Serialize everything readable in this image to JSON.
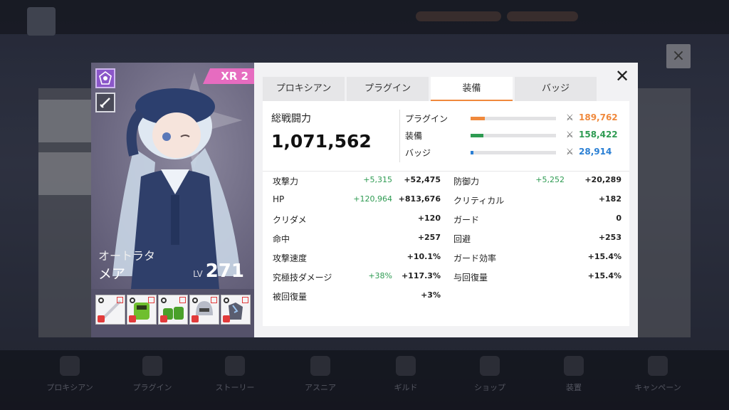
{
  "colors": {
    "plugin": "#f0893c",
    "equip": "#2e9b52",
    "badge": "#2a7fd4",
    "xr_tag": "#e66cc0",
    "tab_active_underline": "#f0893c",
    "bonus": "#2e9b52"
  },
  "character": {
    "xr_rank": "XR 2",
    "title": "オートラタ",
    "name": "メア",
    "lv_label": "LV",
    "level": "271",
    "attribute_icon": "attribute-icon",
    "weapon_icon": "sword-icon",
    "equipment": [
      {
        "name": "equipment-slot-1",
        "icon": "blade-icon",
        "color": "#c9c9d2"
      },
      {
        "name": "equipment-slot-2",
        "icon": "armor-green-icon",
        "color": "#6fbf2e"
      },
      {
        "name": "equipment-slot-3",
        "icon": "boots-green-icon",
        "color": "#4aa02a"
      },
      {
        "name": "equipment-slot-4",
        "icon": "helmet-icon",
        "color": "#b8bcc8"
      },
      {
        "name": "equipment-slot-5",
        "icon": "gauntlet-icon",
        "color": "#5a5e70"
      }
    ]
  },
  "tabs": [
    {
      "label": "プロキシアン",
      "active": false
    },
    {
      "label": "プラグイン",
      "active": false
    },
    {
      "label": "装備",
      "active": true
    },
    {
      "label": "バッジ",
      "active": false
    }
  ],
  "power": {
    "label": "総戦闘力",
    "value": "1,071,562"
  },
  "breakdown": [
    {
      "label": "プラグイン",
      "value": "189,762",
      "fraction": 0.17,
      "color": "#f0893c"
    },
    {
      "label": "装備",
      "value": "158,422",
      "fraction": 0.15,
      "color": "#2e9b52"
    },
    {
      "label": "バッジ",
      "value": "28,914",
      "fraction": 0.03,
      "color": "#2a7fd4"
    }
  ],
  "stats_left": [
    {
      "label": "攻撃力",
      "bonus": "+5,315",
      "value": "+52,475"
    },
    {
      "label": "HP",
      "bonus": "+120,964",
      "value": "+813,676"
    },
    {
      "label": "クリダメ",
      "bonus": "",
      "value": "+120"
    },
    {
      "label": "命中",
      "bonus": "",
      "value": "+257"
    },
    {
      "label": "攻撃速度",
      "bonus": "",
      "value": "+10.1%"
    },
    {
      "label": "究極技ダメージ",
      "bonus": "+38%",
      "value": "+117.3%"
    },
    {
      "label": "被回復量",
      "bonus": "",
      "value": "+3%"
    }
  ],
  "stats_right": [
    {
      "label": "防御力",
      "bonus": "+5,252",
      "value": "+20,289"
    },
    {
      "label": "クリティカル",
      "bonus": "",
      "value": "+182"
    },
    {
      "label": "ガード",
      "bonus": "",
      "value": "0"
    },
    {
      "label": "回避",
      "bonus": "",
      "value": "+253"
    },
    {
      "label": "ガード効率",
      "bonus": "",
      "value": "+15.4%"
    },
    {
      "label": "与回復量",
      "bonus": "",
      "value": "+15.4%"
    }
  ],
  "background": {
    "nav": [
      "プロキシアン",
      "プラグイン",
      "ストーリー",
      "アスニア",
      "ギルド",
      "ショップ",
      "装置",
      "キャンペーン"
    ]
  }
}
